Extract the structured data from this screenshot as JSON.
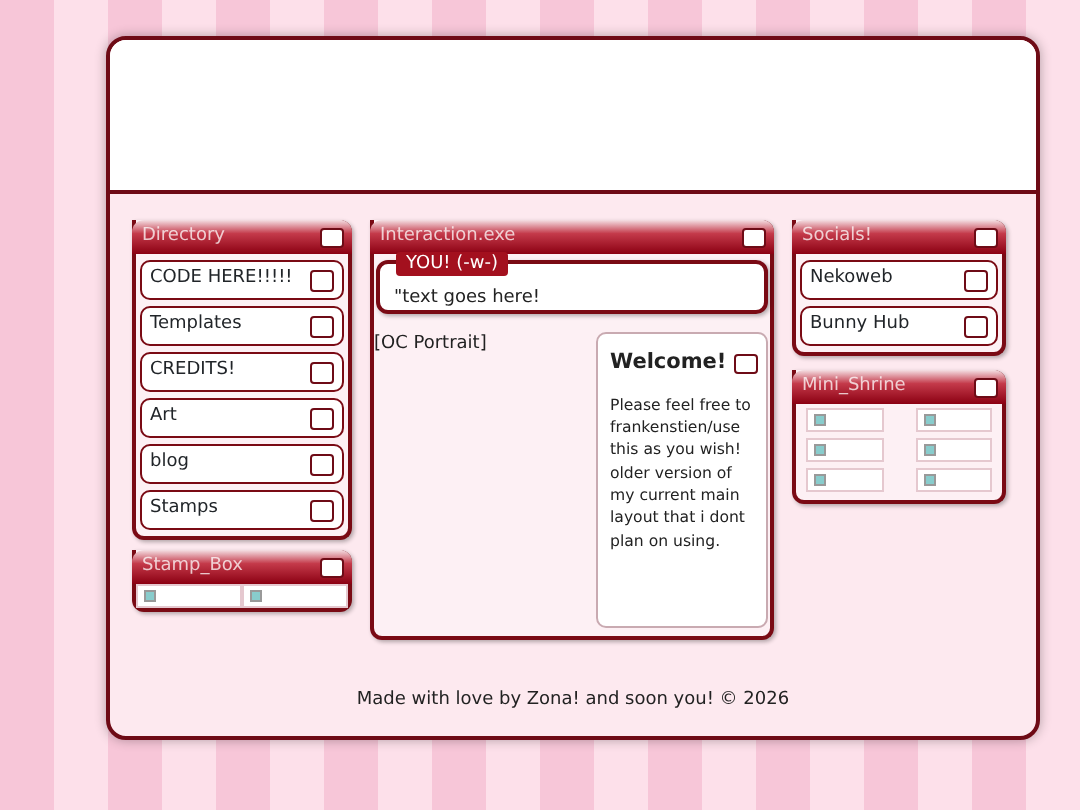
{
  "directory": {
    "title": "Directory",
    "items": [
      "CODE HERE!!!!!",
      "Templates",
      "CREDITS!",
      "Art",
      "blog",
      "Stamps"
    ]
  },
  "stamp_box": {
    "title": "Stamp_Box",
    "images": [
      {
        "kind": "broken"
      },
      {
        "kind": "broken"
      }
    ]
  },
  "interaction": {
    "title": "Interaction.exe",
    "speaker": "YOU! (-w-)",
    "dialogue": "\"text goes here!",
    "portrait_alt": "[OC Portrait]"
  },
  "welcome": {
    "title": "Welcome!",
    "text": "Please feel free to frankenstien/use this as you wish! older version of my current main layout that i dont plan on using."
  },
  "socials": {
    "title": "Socials!",
    "items": [
      "Nekoweb",
      "Bunny Hub"
    ]
  },
  "mini_shrine": {
    "title": "Mini_Shrine",
    "images": [
      {
        "kind": "broken"
      },
      {
        "kind": "broken"
      },
      {
        "kind": "broken"
      },
      {
        "kind": "broken"
      },
      {
        "kind": "broken"
      },
      {
        "kind": "broken"
      }
    ]
  },
  "footer": "Made with love by Zona! and soon you! © 2026"
}
